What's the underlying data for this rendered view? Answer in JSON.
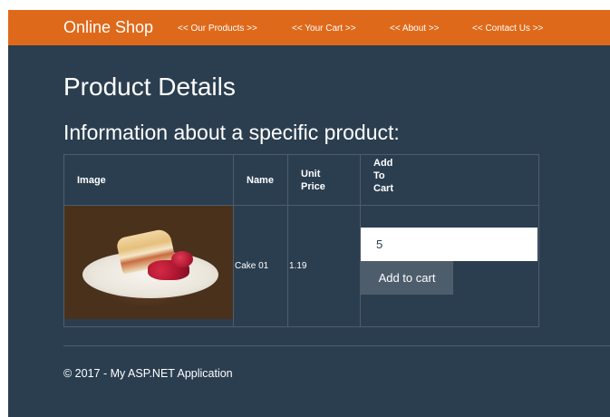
{
  "navbar": {
    "brand": "Online Shop",
    "links": [
      "<< Our Products >>",
      "<< Your Cart >>",
      "<< About >>",
      "<< Contact Us >>"
    ],
    "color": "#df691a"
  },
  "page": {
    "title": "Product Details",
    "subtitle": "Information about a specific product:",
    "background": "#2b3e50"
  },
  "table": {
    "headers": {
      "image": "Image",
      "name": "Name",
      "unit_price": "Unit Price",
      "add_to_cart": "Add To Cart"
    },
    "rows": [
      {
        "image_icon": "cake-photo",
        "name": "Cake 01",
        "unit_price": "1.19",
        "quantity": "5",
        "add_button": "Add to cart"
      }
    ]
  },
  "footer": {
    "text": "© 2017 - My ASP.NET Application"
  }
}
